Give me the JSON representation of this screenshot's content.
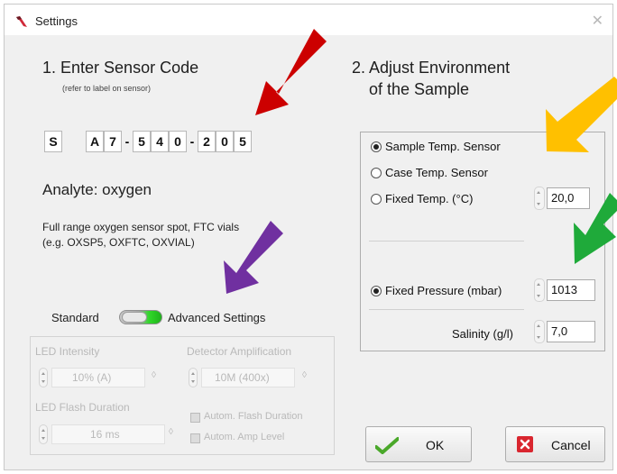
{
  "window": {
    "title": "Settings",
    "close_label": "✕"
  },
  "sensor": {
    "heading": "1. Enter Sensor Code",
    "hint": "(refer to label on sensor)",
    "code_chars": [
      "S",
      "A",
      "7",
      "5",
      "4",
      "0",
      "2",
      "0",
      "5"
    ],
    "separator": "-",
    "analyte_label": "Analyte:",
    "analyte_value": "oxygen",
    "description_line1": "Full range oxygen sensor spot, FTC vials",
    "description_line2": "(e.g. OXSP5, OXFTC, OXVIAL)"
  },
  "mode_toggle": {
    "left_label": "Standard",
    "right_label": "Advanced Settings",
    "state": "advanced"
  },
  "advanced": {
    "led_intensity_label": "LED Intensity",
    "led_intensity_value": "10% (A)",
    "detector_amp_label": "Detector Amplification",
    "detector_amp_value": "10M (400x)",
    "led_flash_label": "LED Flash Duration",
    "led_flash_value": "16 ms",
    "autom_flash_label": "Autom. Flash Duration",
    "autom_amp_label": "Autom. Amp Level",
    "suffix": "◊"
  },
  "environment": {
    "heading_line1": "2. Adjust Environment",
    "heading_line2": "of the Sample",
    "options": {
      "sample_temp": "Sample Temp. Sensor",
      "case_temp": "Case Temp. Sensor",
      "fixed_temp": "Fixed Temp. (°C)"
    },
    "selected_temp_option": "sample_temp",
    "fixed_temp_value": "20,0",
    "pressure_label": "Fixed Pressure (mbar)",
    "pressure_value": "1013",
    "salinity_label": "Salinity (g/l)",
    "salinity_value": "7,0"
  },
  "buttons": {
    "ok_label": "OK",
    "cancel_label": "Cancel"
  },
  "colors": {
    "arrow_red": "#cc0000",
    "arrow_orange": "#ffc000",
    "arrow_green": "#1faa3a",
    "arrow_purple": "#7030a0",
    "toggle_green": "#31d82a"
  }
}
